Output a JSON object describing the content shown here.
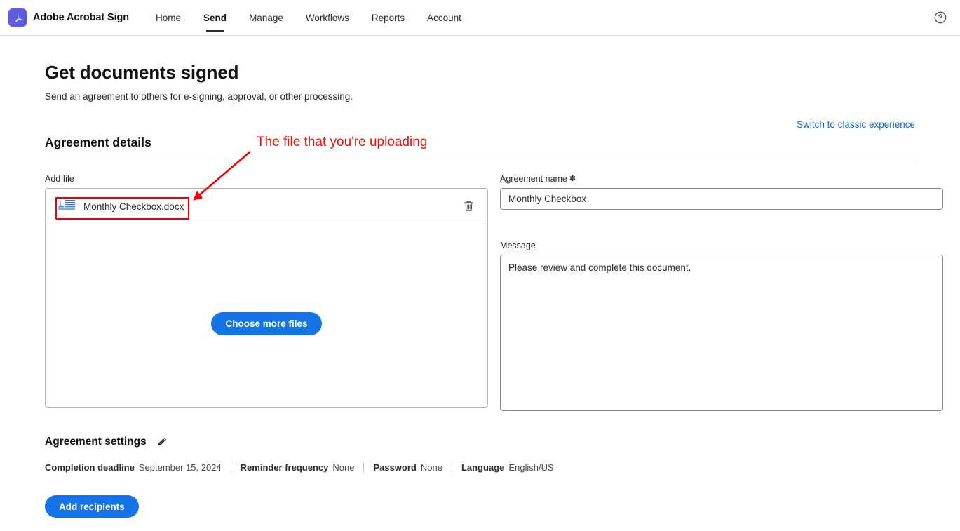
{
  "topbar": {
    "brand_name": "Adobe Acrobat Sign",
    "logo_icon": "adobe-acrobat-logo-icon",
    "nav_items": [
      {
        "label": "Home",
        "active": false
      },
      {
        "label": "Send",
        "active": true
      },
      {
        "label": "Manage",
        "active": false
      },
      {
        "label": "Workflows",
        "active": false
      },
      {
        "label": "Reports",
        "active": false
      },
      {
        "label": "Account",
        "active": false
      }
    ],
    "help_icon": "help-circle-icon"
  },
  "page": {
    "title": "Get documents signed",
    "subtitle": "Send an agreement to others for e-signing, approval, or other processing.",
    "classic_link": "Switch to classic experience"
  },
  "section": {
    "title": "Agreement details"
  },
  "add_file": {
    "label": "Add file",
    "file_icon": "text-document-icon",
    "file_name": "Monthly Checkbox.docx",
    "delete_icon": "trash-icon",
    "choose_more_label": "Choose more files"
  },
  "agreement_name": {
    "label": "Agreement name",
    "required_marker": "✽",
    "value": "Monthly Checkbox",
    "placeholder": ""
  },
  "message": {
    "label": "Message",
    "value": "Please review and complete this document.",
    "placeholder": ""
  },
  "agreement_settings": {
    "title": "Agreement settings",
    "edit_icon": "pencil-icon",
    "items": [
      {
        "key": "Completion deadline",
        "value": "September 15, 2024"
      },
      {
        "key": "Reminder frequency",
        "value": "None"
      },
      {
        "key": "Password",
        "value": "None"
      },
      {
        "key": "Language",
        "value": "English/US"
      }
    ]
  },
  "footer": {
    "add_recipients_label": "Add recipients"
  },
  "annotation": {
    "text": "The file that you're uploading",
    "color": "#f51000"
  },
  "colors": {
    "brand_purple": "#5c5ce0",
    "accent_blue": "#1473e6",
    "link_blue": "#0d66d0",
    "annotation_red": "#ee0000",
    "text_primary": "#2c2c2c"
  }
}
